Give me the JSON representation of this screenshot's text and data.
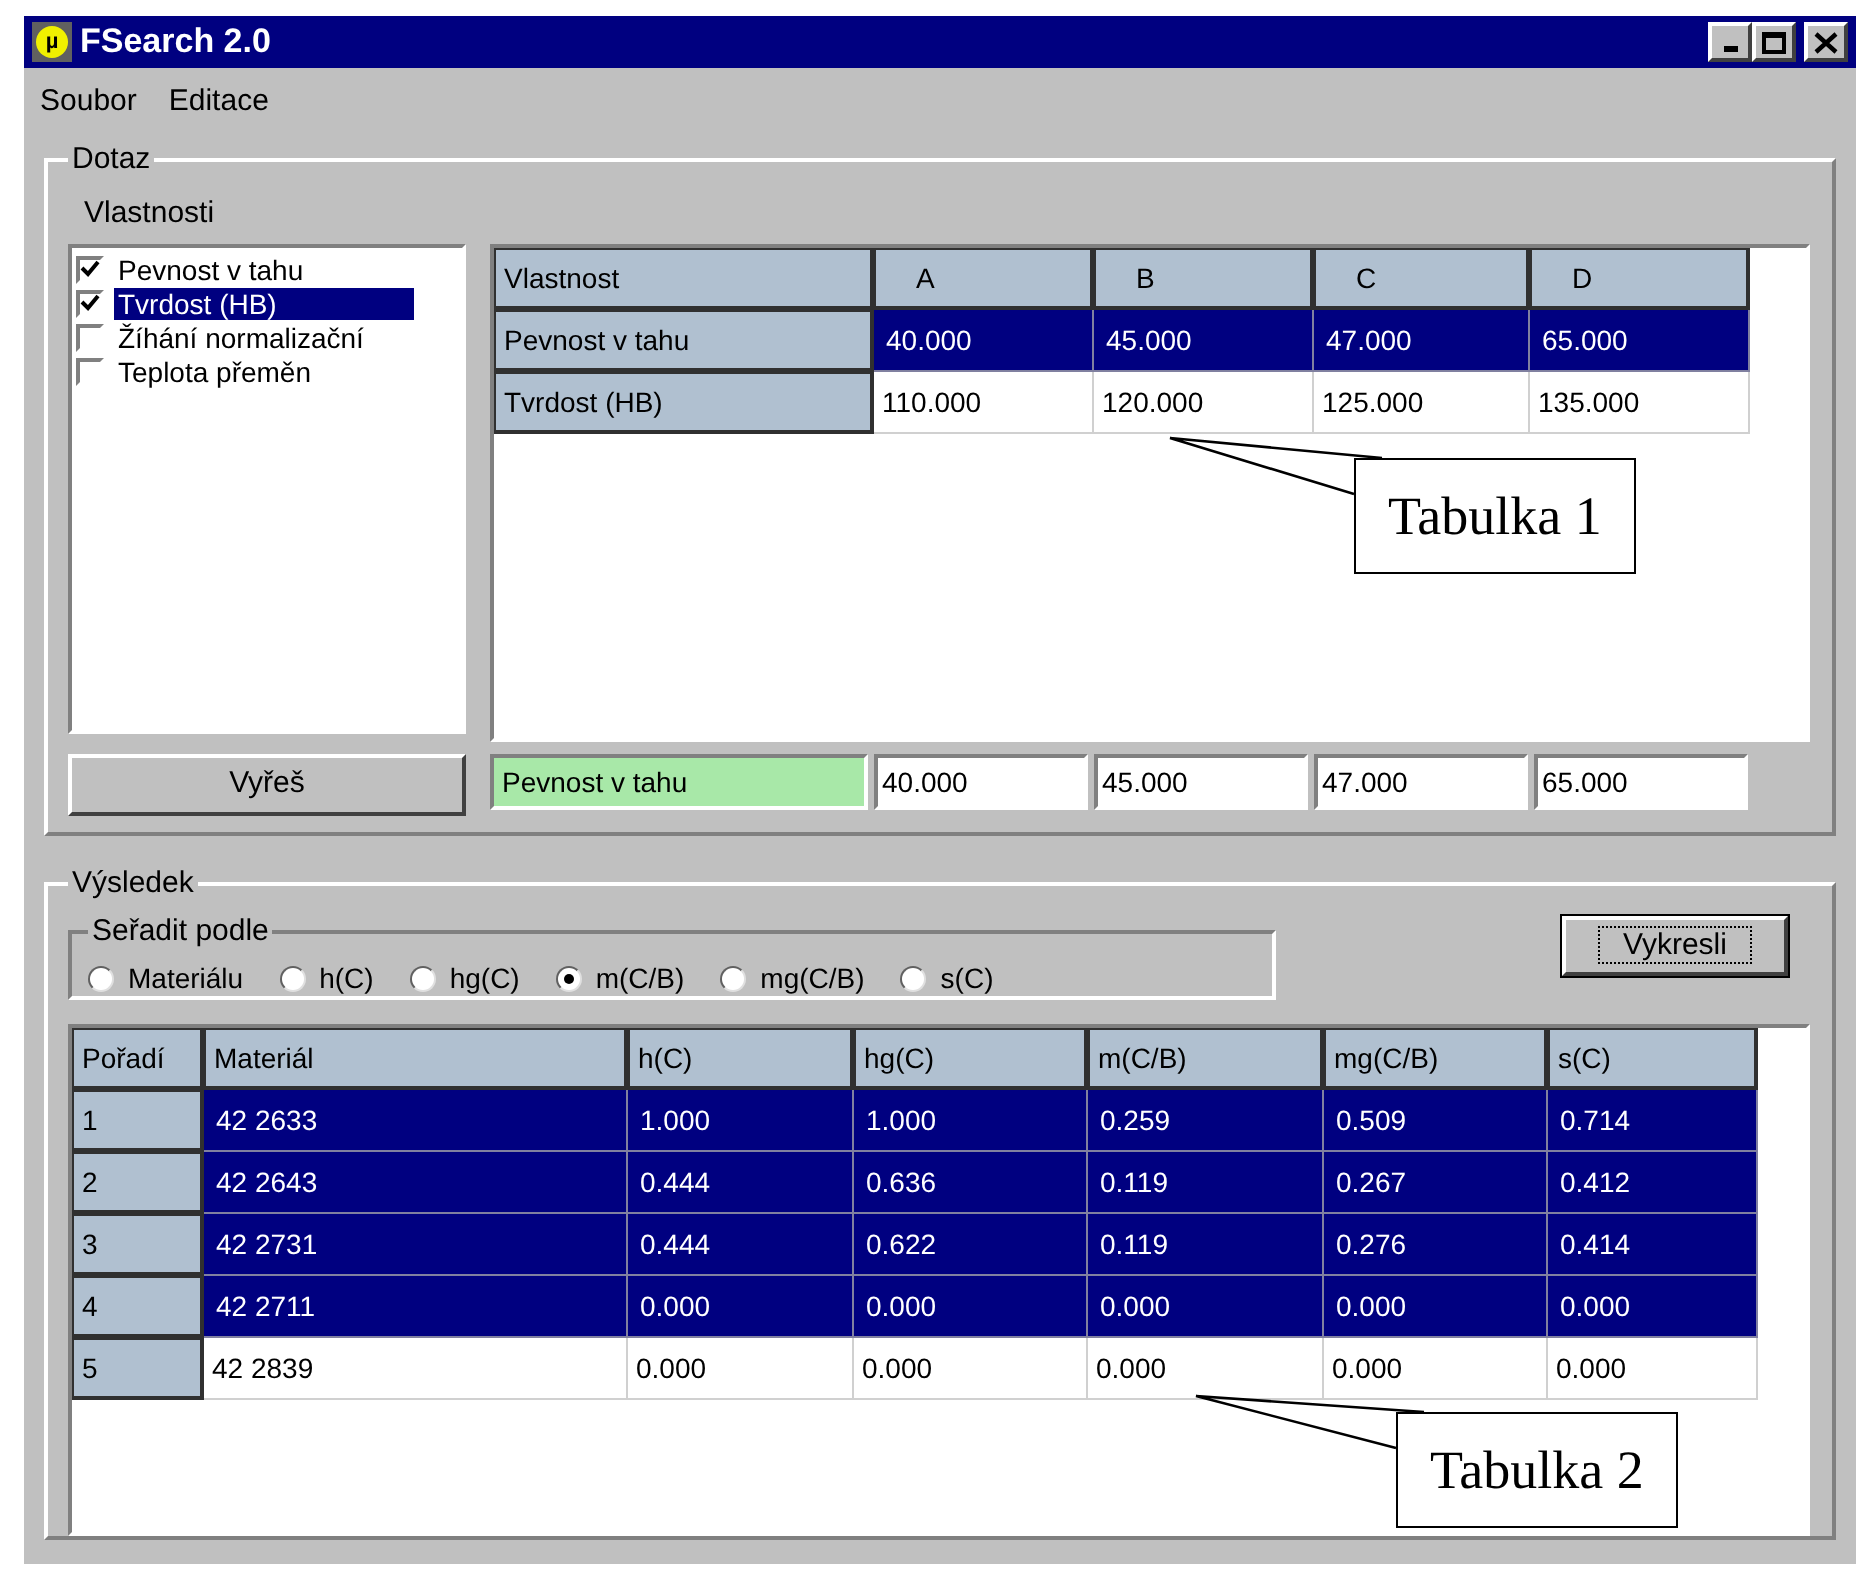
{
  "window": {
    "title": "FSearch 2.0",
    "icon_text": "µ"
  },
  "menu": [
    "Soubor",
    "Editace"
  ],
  "query": {
    "title": "Dotaz",
    "properties_label": "Vlastnosti",
    "properties": [
      {
        "label": "Pevnost v tahu",
        "checked": true,
        "selected": false
      },
      {
        "label": "Tvrdost (HB)",
        "checked": true,
        "selected": true
      },
      {
        "label": "Žíhání normalizační",
        "checked": false,
        "selected": false
      },
      {
        "label": "Teplota přeměn",
        "checked": false,
        "selected": false
      }
    ],
    "table": {
      "columns": [
        "Vlastnost",
        "A",
        "B",
        "C",
        "D"
      ],
      "rows": [
        {
          "cells": [
            "Pevnost v tahu",
            "40.000",
            "45.000",
            "47.000",
            "65.000"
          ],
          "selected": true
        },
        {
          "cells": [
            "Tvrdost (HB)",
            "110.000",
            "120.000",
            "125.000",
            "135.000"
          ],
          "selected": false
        }
      ],
      "callout": "Tabulka 1"
    },
    "cut_button": "Vyřeš",
    "filter_row": {
      "label": "Pevnost v tahu",
      "values": [
        "40.000",
        "45.000",
        "47.000",
        "65.000"
      ]
    }
  },
  "results": {
    "title": "Výsledek",
    "sort": {
      "title": "Seřadit podle",
      "options": [
        {
          "label": "Materiálu",
          "selected": false
        },
        {
          "label": "h(C)",
          "selected": false
        },
        {
          "label": "hg(C)",
          "selected": false
        },
        {
          "label": "m(C/B)",
          "selected": true
        },
        {
          "label": "mg(C/B)",
          "selected": false
        },
        {
          "label": "s(C)",
          "selected": false
        }
      ]
    },
    "draw_button": "Vykresli",
    "table": {
      "columns": [
        "Pořadí",
        "Materiál",
        "h(C)",
        "hg(C)",
        "m(C/B)",
        "mg(C/B)",
        "s(C)"
      ],
      "rows": [
        {
          "cells": [
            "1",
            "42 2633",
            "1.000",
            "1.000",
            "0.259",
            "0.509",
            "0.714"
          ],
          "selected": true
        },
        {
          "cells": [
            "2",
            "42 2643",
            "0.444",
            "0.636",
            "0.119",
            "0.267",
            "0.412"
          ],
          "selected": true
        },
        {
          "cells": [
            "3",
            "42 2731",
            "0.444",
            "0.622",
            "0.119",
            "0.276",
            "0.414"
          ],
          "selected": true
        },
        {
          "cells": [
            "4",
            "42 2711",
            "0.000",
            "0.000",
            "0.000",
            "0.000",
            "0.000"
          ],
          "selected": true
        },
        {
          "cells": [
            "5",
            "42 2839",
            "0.000",
            "0.000",
            "0.000",
            "0.000",
            "0.000"
          ],
          "selected": false
        }
      ],
      "callout": "Tabulka 2"
    }
  }
}
